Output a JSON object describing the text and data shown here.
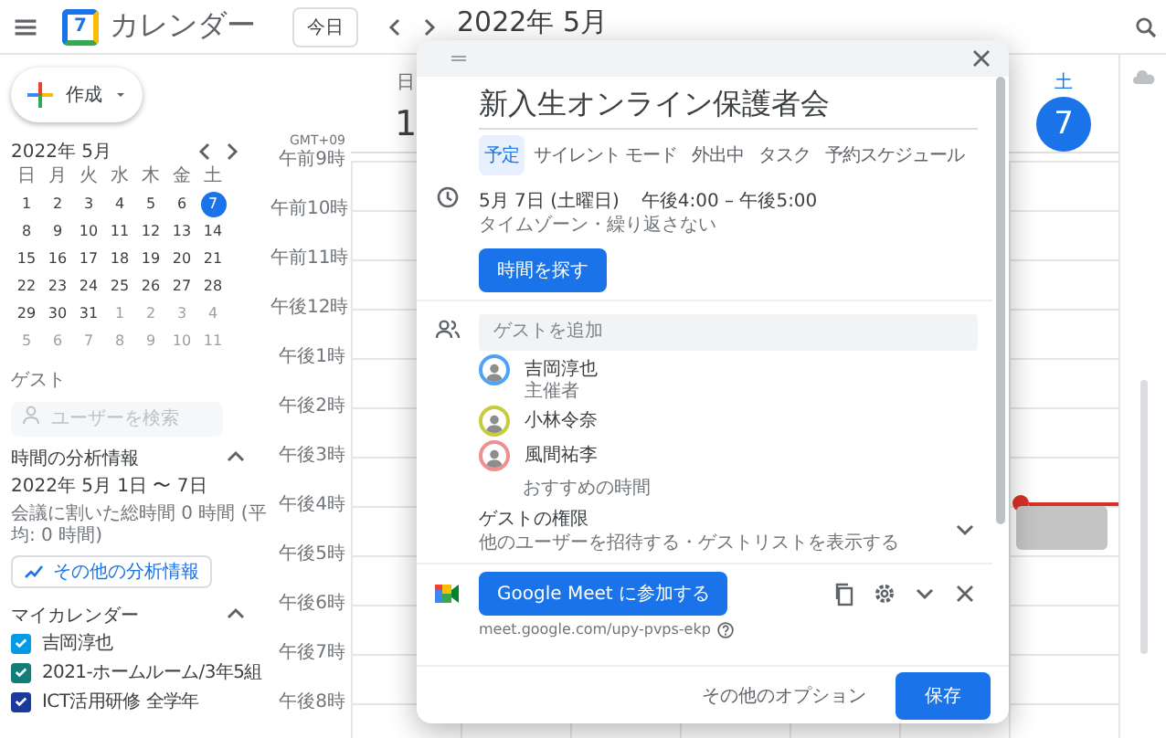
{
  "header": {
    "logo_text": "7",
    "app_title": "カレンダー",
    "today_button": "今日",
    "month_title": "2022年 5月"
  },
  "create_button": "作成",
  "mini_calendar": {
    "title": "2022年 5月",
    "weekdays": [
      "日",
      "月",
      "火",
      "水",
      "木",
      "金",
      "土"
    ],
    "weeks": [
      [
        {
          "label": "1",
          "selected": false,
          "other_month": false
        },
        {
          "label": "2",
          "selected": false,
          "other_month": false
        },
        {
          "label": "3",
          "selected": false,
          "other_month": false
        },
        {
          "label": "4",
          "selected": false,
          "other_month": false
        },
        {
          "label": "5",
          "selected": false,
          "other_month": false
        },
        {
          "label": "6",
          "selected": false,
          "other_month": false
        },
        {
          "label": "7",
          "selected": true,
          "other_month": false
        }
      ],
      [
        {
          "label": "8",
          "selected": false,
          "other_month": false
        },
        {
          "label": "9",
          "selected": false,
          "other_month": false
        },
        {
          "label": "10",
          "selected": false,
          "other_month": false
        },
        {
          "label": "11",
          "selected": false,
          "other_month": false
        },
        {
          "label": "12",
          "selected": false,
          "other_month": false
        },
        {
          "label": "13",
          "selected": false,
          "other_month": false
        },
        {
          "label": "14",
          "selected": false,
          "other_month": false
        }
      ],
      [
        {
          "label": "15",
          "selected": false,
          "other_month": false
        },
        {
          "label": "16",
          "selected": false,
          "other_month": false
        },
        {
          "label": "17",
          "selected": false,
          "other_month": false
        },
        {
          "label": "18",
          "selected": false,
          "other_month": false
        },
        {
          "label": "19",
          "selected": false,
          "other_month": false
        },
        {
          "label": "20",
          "selected": false,
          "other_month": false
        },
        {
          "label": "21",
          "selected": false,
          "other_month": false
        }
      ],
      [
        {
          "label": "22",
          "selected": false,
          "other_month": false
        },
        {
          "label": "23",
          "selected": false,
          "other_month": false
        },
        {
          "label": "24",
          "selected": false,
          "other_month": false
        },
        {
          "label": "25",
          "selected": false,
          "other_month": false
        },
        {
          "label": "26",
          "selected": false,
          "other_month": false
        },
        {
          "label": "27",
          "selected": false,
          "other_month": false
        },
        {
          "label": "28",
          "selected": false,
          "other_month": false
        }
      ],
      [
        {
          "label": "29",
          "selected": false,
          "other_month": false
        },
        {
          "label": "30",
          "selected": false,
          "other_month": false
        },
        {
          "label": "31",
          "selected": false,
          "other_month": false
        },
        {
          "label": "1",
          "selected": false,
          "other_month": true
        },
        {
          "label": "2",
          "selected": false,
          "other_month": true
        },
        {
          "label": "3",
          "selected": false,
          "other_month": true
        },
        {
          "label": "4",
          "selected": false,
          "other_month": true
        }
      ],
      [
        {
          "label": "5",
          "selected": false,
          "other_month": true
        },
        {
          "label": "6",
          "selected": false,
          "other_month": true
        },
        {
          "label": "7",
          "selected": false,
          "other_month": true
        },
        {
          "label": "8",
          "selected": false,
          "other_month": true
        },
        {
          "label": "9",
          "selected": false,
          "other_month": true
        },
        {
          "label": "10",
          "selected": false,
          "other_month": true
        },
        {
          "label": "11",
          "selected": false,
          "other_month": true
        }
      ]
    ]
  },
  "guest_search": {
    "label": "ゲスト",
    "placeholder": "ユーザーを検索"
  },
  "insights": {
    "title": "時間の分析情報",
    "expanded": true,
    "range": "2022年 5月 1日 〜 7日",
    "summary": "会議に割いた総時間 0 時間 (平均: 0 時間)",
    "button": "その他の分析情報"
  },
  "my_calendars": {
    "title": "マイカレンダー",
    "expanded": true,
    "items": [
      {
        "name": "吉岡淳也",
        "checked": true,
        "color": "#039be5"
      },
      {
        "name": "2021-ホームルーム/3年5組",
        "checked": true,
        "color": "#137d78"
      },
      {
        "name": "ICT活用研修 全学年",
        "checked": true,
        "color": "#1a3a9c"
      }
    ]
  },
  "week": {
    "timezone": "GMT+09",
    "days": [
      {
        "weekday": "日",
        "date": "1",
        "today": false
      },
      {
        "weekday": "土",
        "date": "7",
        "today": true
      }
    ],
    "time_labels": [
      "午前9時",
      "午前10時",
      "午前11時",
      "午後12時",
      "午後1時",
      "午後2時",
      "午後3時",
      "午後4時",
      "午後5時",
      "午後6時",
      "午後7時",
      "午後8時"
    ]
  },
  "dialog": {
    "title": "新入生オンライン保護者会",
    "tabs": [
      {
        "label": "予定",
        "selected": true
      },
      {
        "label": "サイレント モード",
        "selected": false
      },
      {
        "label": "外出中",
        "selected": false
      },
      {
        "label": "タスク",
        "selected": false
      },
      {
        "label": "予約スケジュール",
        "selected": false
      }
    ],
    "date": "5月 7日 (土曜日)",
    "time": "午後4:00 – 午後5:00",
    "recurrence": "タイムゾーン・繰り返さない",
    "find_time_button": "時間を探す",
    "guest_placeholder": "ゲストを追加",
    "guests": [
      {
        "name": "吉岡淳也",
        "role": "主催者",
        "color": "#4fa3f7"
      },
      {
        "name": "小林令奈",
        "color": "#c6cc3a"
      },
      {
        "name": "風間祐李",
        "color": "#ef8f8f"
      }
    ],
    "suggested_times": "おすすめの時間",
    "permissions": {
      "title": "ゲストの権限",
      "subtitle": "他のユーザーを招待する・ゲストリストを表示する"
    },
    "meet": {
      "button": "Google Meet に参加する",
      "link": "meet.google.com/upy-pvps-ekp"
    },
    "footer": {
      "more_options": "その他のオプション",
      "save": "保存"
    }
  }
}
